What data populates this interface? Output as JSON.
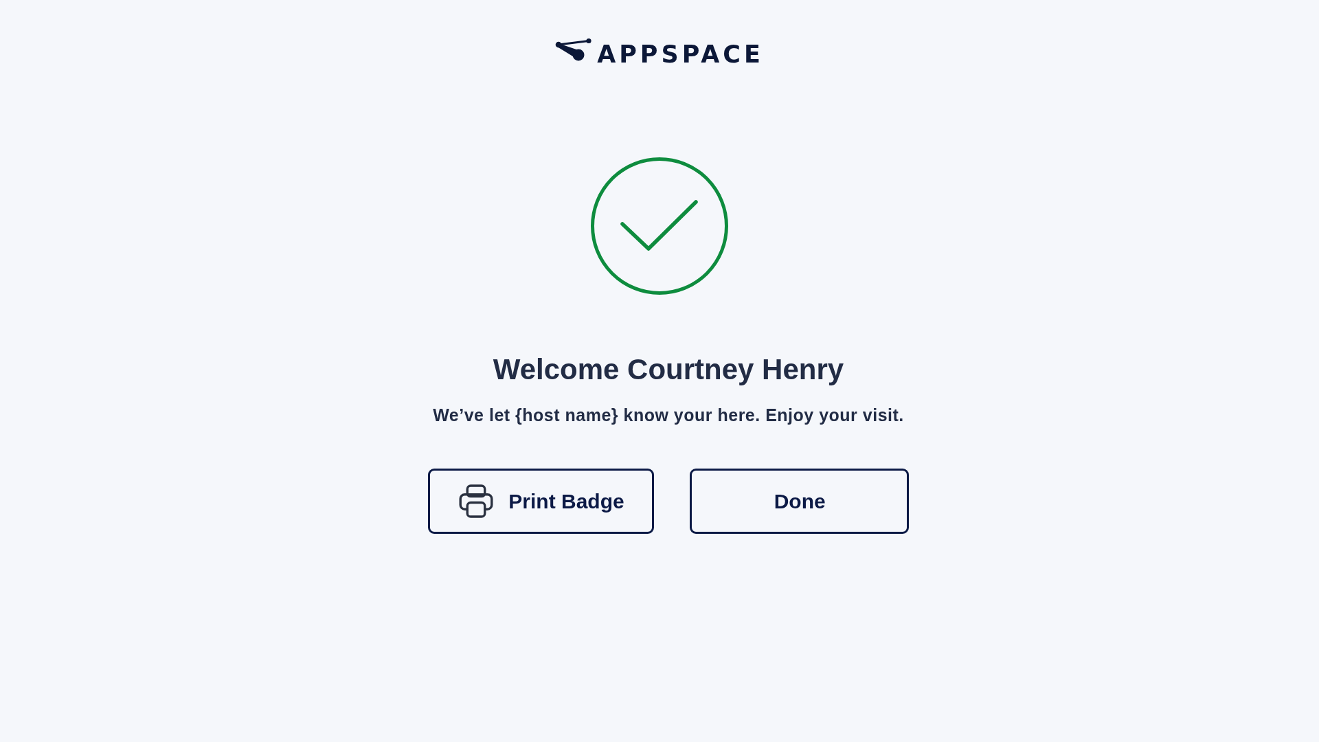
{
  "logo": {
    "text": "APPSPACE"
  },
  "status": {
    "kind": "success"
  },
  "title": "Welcome Courtney Henry",
  "message": "We’ve let {host name} know your here. Enjoy your visit.",
  "buttons": [
    {
      "label": "Print Badge",
      "kind": "print"
    },
    {
      "label": "Done",
      "kind": "plain"
    }
  ]
}
